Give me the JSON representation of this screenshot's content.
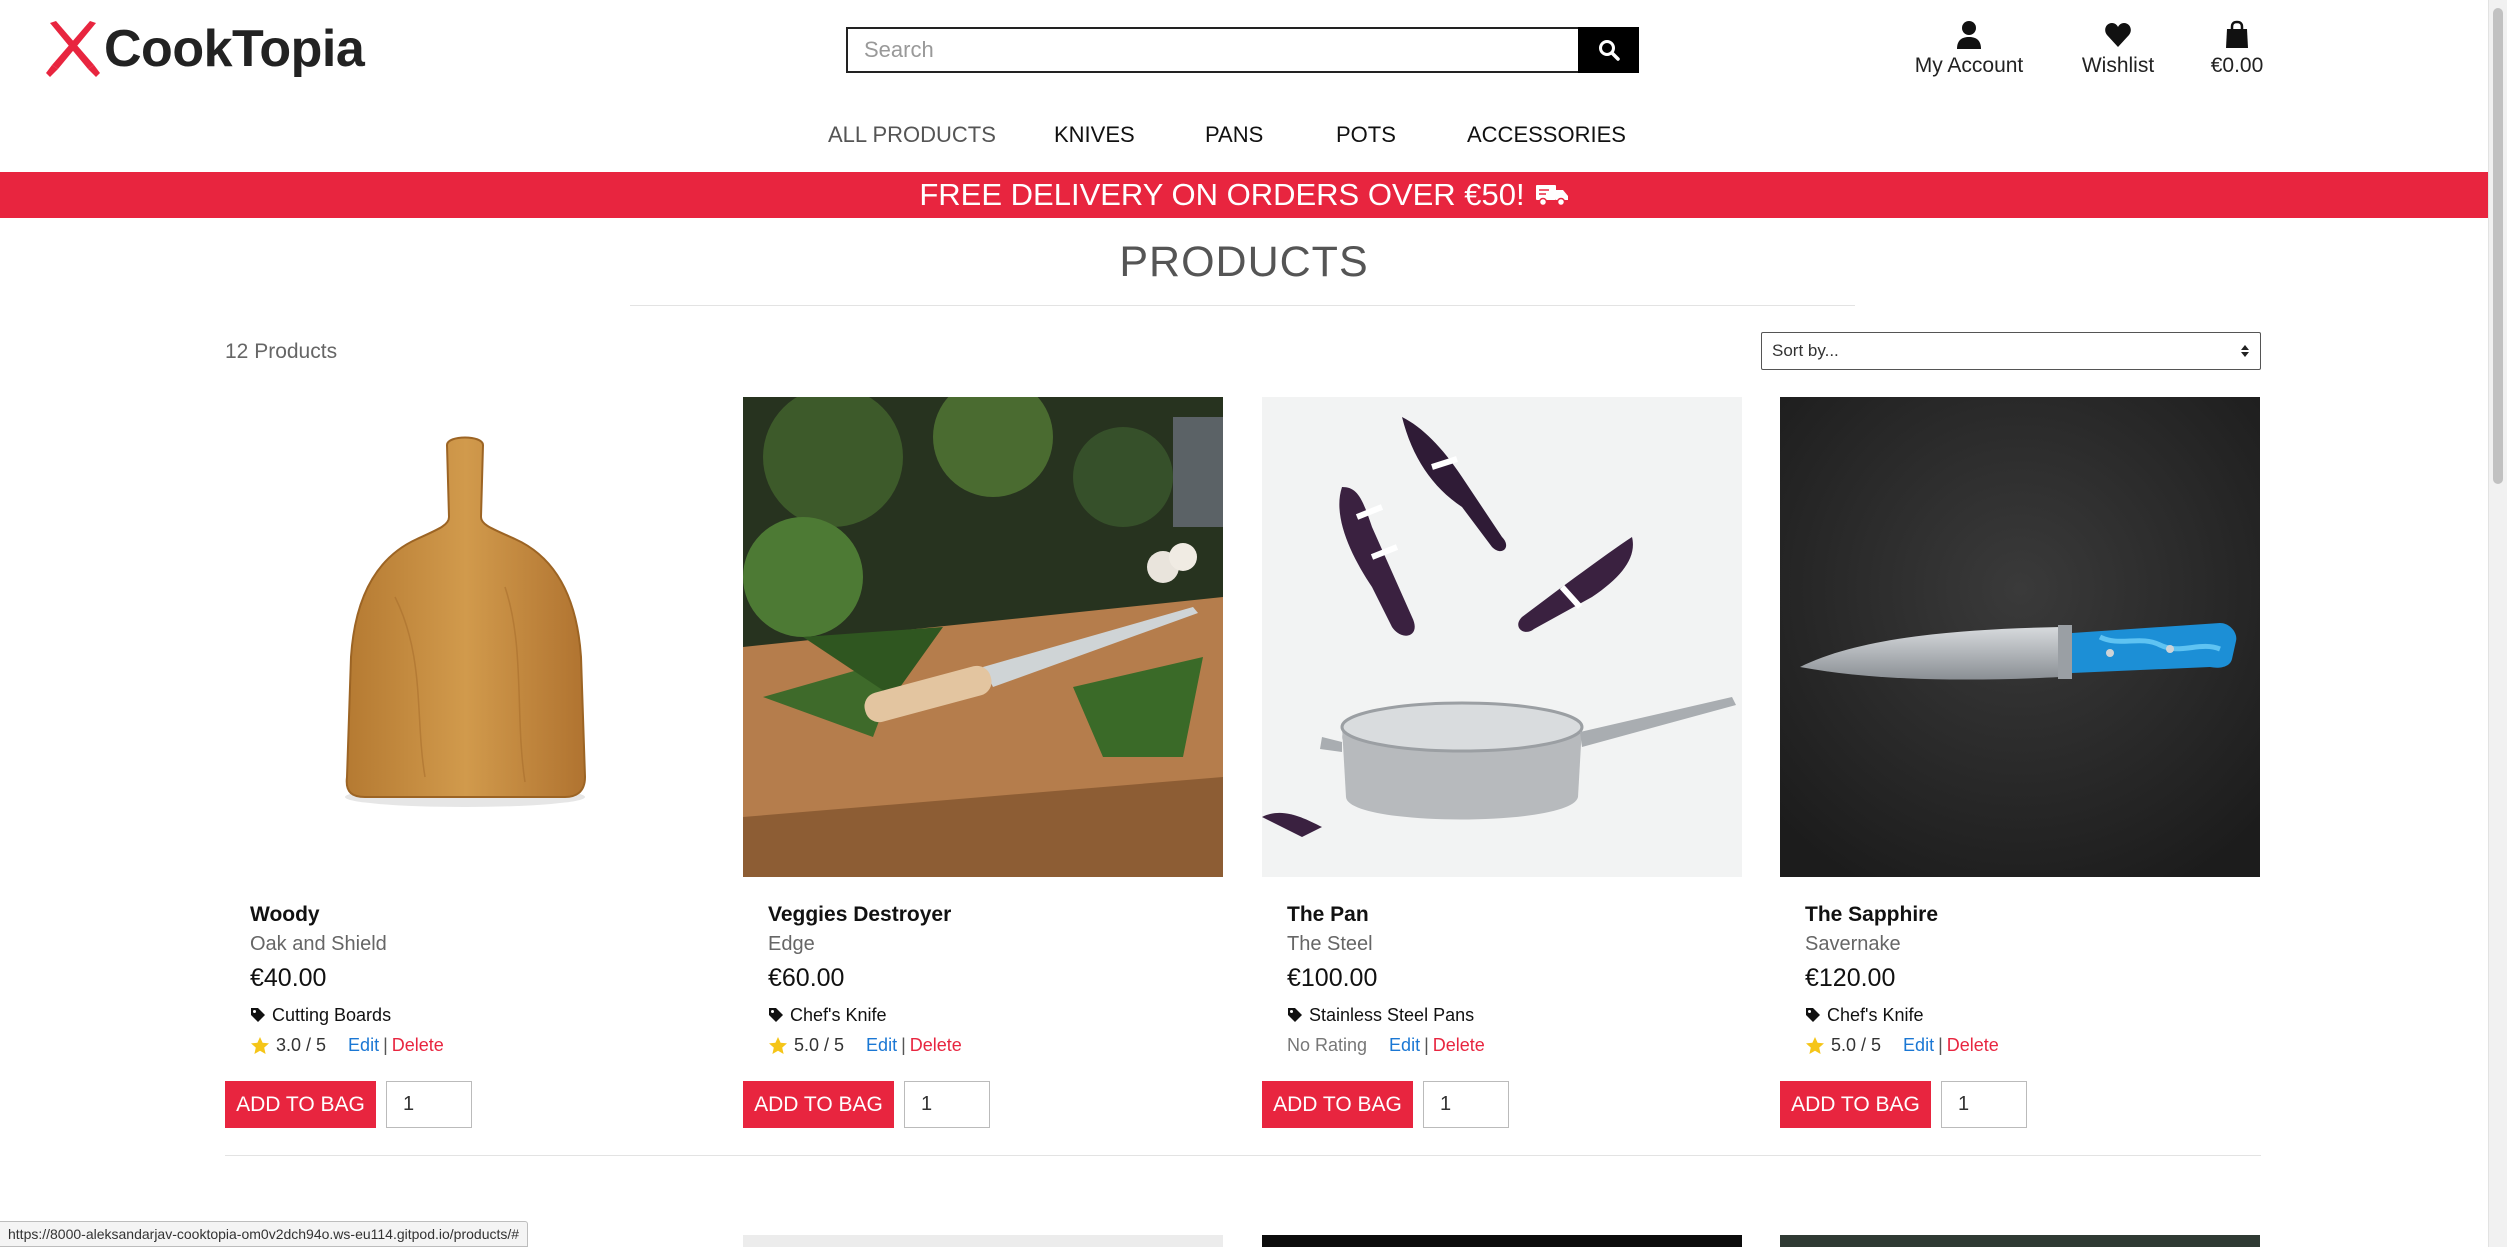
{
  "brand": {
    "name": "CookTopia"
  },
  "search": {
    "placeholder": "Search"
  },
  "account_nav": {
    "my_account": "My Account",
    "wishlist": "Wishlist",
    "bag_total": "€0.00"
  },
  "main_nav": [
    "ALL PRODUCTS",
    "KNIVES",
    "PANS",
    "POTS",
    "ACCESSORIES"
  ],
  "banner": {
    "text": "FREE DELIVERY ON ORDERS OVER €50!"
  },
  "page": {
    "title": "PRODUCTS",
    "count": "12 Products",
    "sort_label": "Sort by..."
  },
  "products": [
    {
      "name": "Woody",
      "brand": "Oak and Shield",
      "price": "€40.00",
      "category": "Cutting Boards",
      "rating": "3.0 / 5",
      "edit": "Edit",
      "sep": "|",
      "delete": "Delete",
      "button": "ADD TO BAG",
      "qty": "1"
    },
    {
      "name": "Veggies Destroyer",
      "brand": "Edge",
      "price": "€60.00",
      "category": "Chef's Knife",
      "rating": "5.0 / 5",
      "edit": "Edit",
      "sep": "|",
      "delete": "Delete",
      "button": "ADD TO BAG",
      "qty": "1"
    },
    {
      "name": "The Pan",
      "brand": "The Steel",
      "price": "€100.00",
      "category": "Stainless Steel Pans",
      "rating": "No Rating",
      "edit": "Edit",
      "sep": "|",
      "delete": "Delete",
      "button": "ADD TO BAG",
      "qty": "1"
    },
    {
      "name": "The Sapphire",
      "brand": "Savernake",
      "price": "€120.00",
      "category": "Chef's Knife",
      "rating": "5.0 / 5",
      "edit": "Edit",
      "sep": "|",
      "delete": "Delete",
      "button": "ADD TO BAG",
      "qty": "1"
    }
  ],
  "status_bar": {
    "url": "https://8000-aleksandarjav-cooktopia-om0v2dch94o.ws-eu114.gitpod.io/products/#"
  },
  "colors": {
    "accent": "#e8253f",
    "link": "#1a77d4",
    "star": "#f5c518"
  }
}
